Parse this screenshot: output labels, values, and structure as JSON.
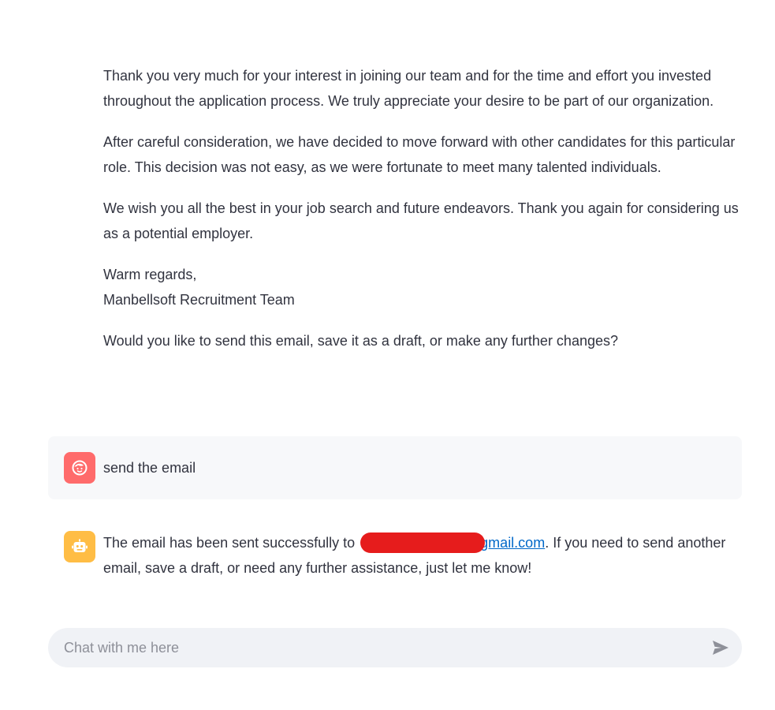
{
  "conversation": {
    "assistant_email_body": {
      "paragraphs": [
        "Thank you very much for your interest in joining our team and for the time and effort you invested throughout the application process. We truly appreciate your desire to be part of our organization.",
        "After careful consideration, we have decided to move forward with other candidates for this particular role. This decision was not easy, as we were fortunate to meet many talented individuals.",
        "We wish you all the best in your job search and future endeavors. Thank you again for considering us as a potential employer."
      ],
      "signoff_line1": "Warm regards,",
      "signoff_line2": "Manbellsoft Recruitment Team",
      "question": "Would you like to send this email, save it as a draft, or make any further changes?"
    },
    "user_message": {
      "text": "send the email",
      "avatar_icon": "user-face-icon",
      "avatar_color": "#ff6b6b"
    },
    "bot_message": {
      "prefix": "The email has been sent successfully to ",
      "email_domain": "gmail.com",
      "suffix": ". If you need to send another email, save a draft, or need any further assistance, just let me know!",
      "redaction_color": "#e61c1c",
      "avatar_icon": "robot-icon",
      "avatar_color": "#ffbd45"
    }
  },
  "chat_input": {
    "placeholder": "Chat with me here",
    "send_icon": "send-icon"
  },
  "colors": {
    "link": "#0068c9",
    "text": "#31333f",
    "user_bubble_bg": "#f7f8fa",
    "input_bg": "#f0f2f6"
  }
}
